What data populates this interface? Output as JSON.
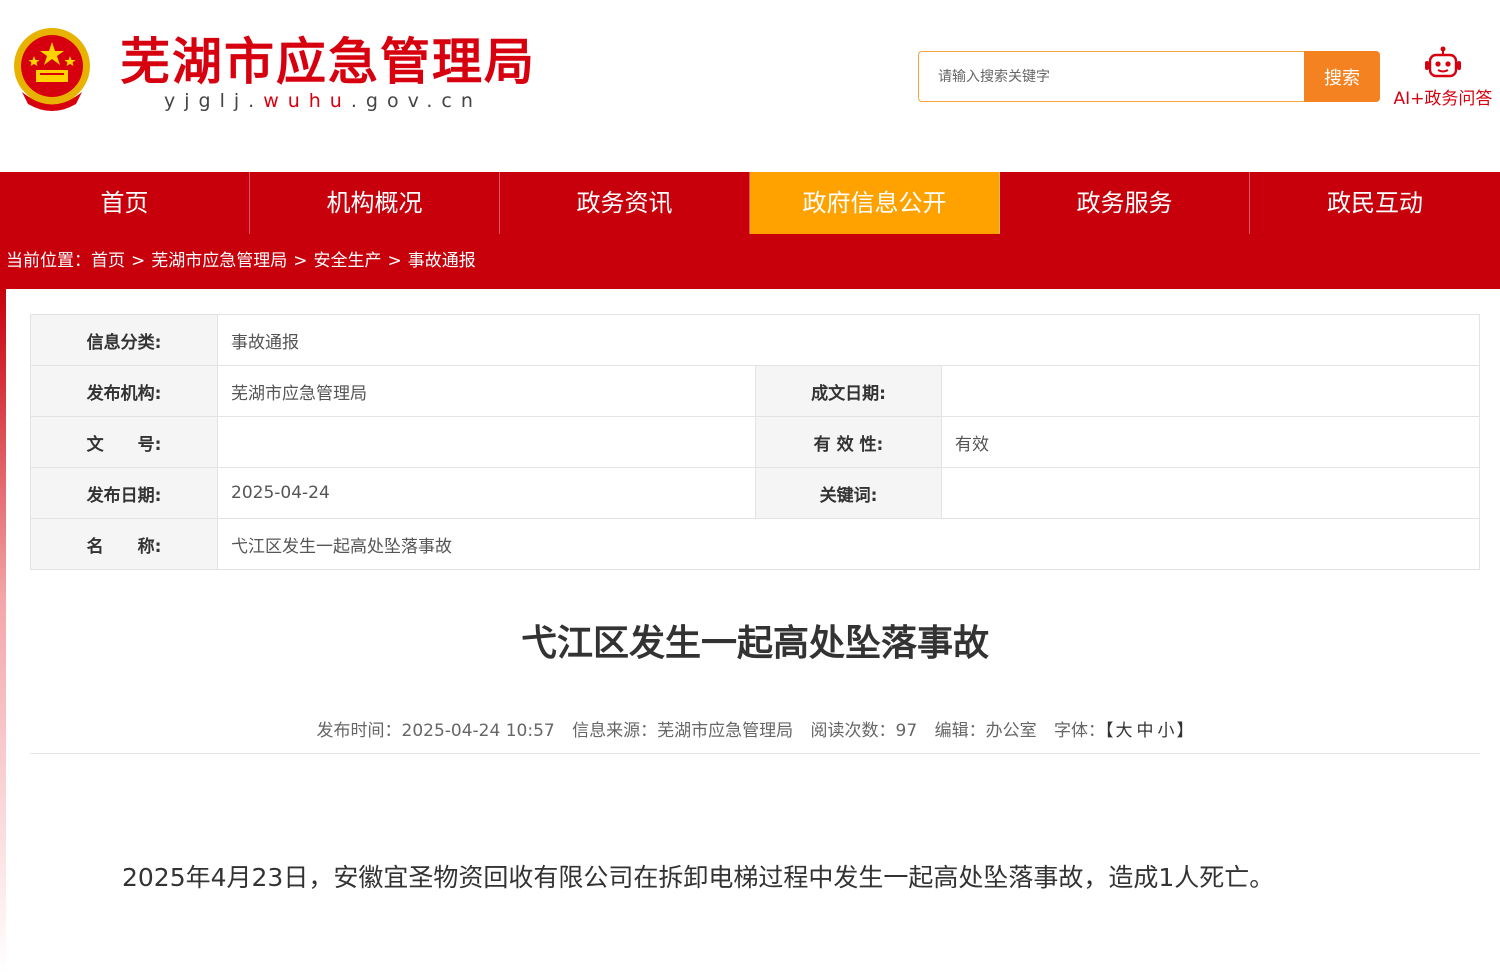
{
  "header": {
    "site_title": "芜湖市应急管理局",
    "domain_dark_1": "yjglj.",
    "domain_red": "wuhu",
    "domain_dark_2": ".gov.cn",
    "search_placeholder": "请输入搜索关键字",
    "search_button": "搜索",
    "ai_label": "AI+政务问答"
  },
  "nav": {
    "items": [
      {
        "label": "首页",
        "active": false
      },
      {
        "label": "机构概况",
        "active": false
      },
      {
        "label": "政务资讯",
        "active": false
      },
      {
        "label": "政府信息公开",
        "active": true
      },
      {
        "label": "政务服务",
        "active": false
      },
      {
        "label": "政民互动",
        "active": false
      }
    ]
  },
  "breadcrumb": {
    "prefix": "当前位置：",
    "items": [
      "首页",
      "芜湖市应急管理局",
      "安全生产",
      "事故通报"
    ],
    "separator": ">"
  },
  "info": {
    "category_label": "信息分类:",
    "category_value": "事故通报",
    "publisher_label": "发布机构:",
    "publisher_value": "芜湖市应急管理局",
    "written_date_label": "成文日期:",
    "written_date_value": "",
    "doc_no_label": "文　　号:",
    "doc_no_value": "",
    "validity_label": "有 效 性:",
    "validity_value": "有效",
    "publish_date_label": "发布日期:",
    "publish_date_value": "2025-04-24",
    "keywords_label": "关键词:",
    "keywords_value": "",
    "name_label": "名　　称:",
    "name_value": "弋江区发生一起高处坠落事故"
  },
  "article": {
    "title": "弋江区发生一起高处坠落事故",
    "meta_time": "发布时间：2025-04-24 10:57",
    "meta_source": "信息来源：芜湖市应急管理局",
    "meta_reads": "阅读次数：97",
    "meta_editor": "编辑：办公室",
    "meta_font_label": "字体：",
    "font_open": "【",
    "font_large": "大",
    "font_medium": "中",
    "font_small": "小",
    "font_close": "】",
    "body": "2025年4月23日，安徽宜圣物资回收有限公司在拆卸电梯过程中发生一起高处坠落事故，造成1人死亡。"
  },
  "colors": {
    "brand_red": "#c7000b",
    "title_red": "#d7000f",
    "active_orange": "#ffa200",
    "search_orange": "#f58220"
  }
}
